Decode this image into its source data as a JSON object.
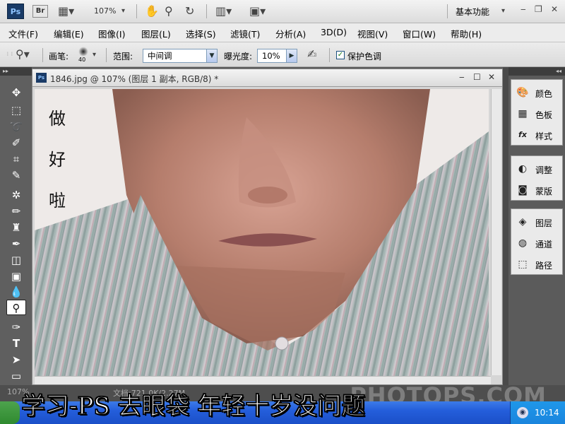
{
  "app": {
    "logo": "Ps",
    "bridge": "Br",
    "zoom": "107%",
    "workspace": "基本功能"
  },
  "menu": [
    "文件(F)",
    "编辑(E)",
    "图像(I)",
    "图层(L)",
    "选择(S)",
    "滤镜(T)",
    "分析(A)",
    "3D(D)",
    "视图(V)",
    "窗口(W)",
    "帮助(H)"
  ],
  "options": {
    "brush_label": "画笔:",
    "brush_size": "40",
    "range_label": "范围:",
    "range_value": "中间调",
    "exposure_label": "曝光度:",
    "exposure_value": "10%",
    "protect_label": "保护色调"
  },
  "document": {
    "title": "1846.jpg @ 107% (图层 1 副本, RGB/8) *",
    "overlay_text": [
      "做",
      "好",
      "啦"
    ]
  },
  "panels": {
    "group1": [
      "颜色",
      "色板",
      "样式"
    ],
    "group2": [
      "调整",
      "蒙版"
    ],
    "group3": [
      "图层",
      "通道",
      "路径"
    ]
  },
  "status": {
    "zoom": "107%",
    "doc_info": "文档:721.0K/2.27M"
  },
  "watermark": "PHOTOPS.COM",
  "caption": "学习-PS 去眼袋 年轻十岁没问题",
  "taskbar": {
    "clock": "10:14"
  },
  "colors": {
    "accent": "#1a3b67",
    "taskbar": "#245edb",
    "panel_bg": "#5b5b5b"
  }
}
